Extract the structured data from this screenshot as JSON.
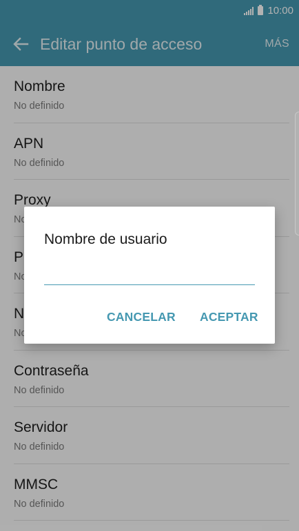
{
  "status_bar": {
    "time": "10:00",
    "icons": [
      "signal-icon",
      "battery-icon"
    ]
  },
  "app_bar": {
    "title": "Editar punto de acceso",
    "more_label": "MÁS",
    "back_icon": "arrow-left-icon",
    "background_color": "#4598b1"
  },
  "settings": {
    "items": [
      {
        "title": "Nombre",
        "value": "No definido"
      },
      {
        "title": "APN",
        "value": "No definido"
      },
      {
        "title": "Proxy",
        "value": "No"
      },
      {
        "title": "P",
        "value": "No"
      },
      {
        "title": "N",
        "value": "No"
      },
      {
        "title": "Contraseña",
        "value": "No definido"
      },
      {
        "title": "Servidor",
        "value": "No definido"
      },
      {
        "title": "MMSC",
        "value": "No definido"
      }
    ]
  },
  "dialog": {
    "title": "Nombre de usuario",
    "input_value": "",
    "cancel_label": "CANCELAR",
    "accept_label": "ACEPTAR",
    "accent_color": "#4598b1"
  }
}
